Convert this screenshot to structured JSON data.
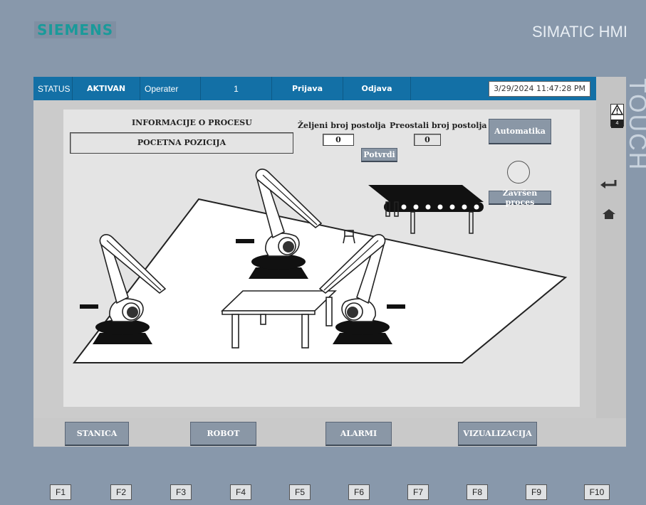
{
  "header": {
    "brand": "SIEMENS",
    "product": "SIMATIC HMI",
    "side_text": "TOUCH"
  },
  "status_bar": {
    "status_label": "STATUS",
    "status_value": "AKTIVAN",
    "user_label": "Operater",
    "user_level": "1",
    "login": "Prijava",
    "logout": "Odjava",
    "datetime": "3/29/2024 11:47:28 PM"
  },
  "side": {
    "alarm_count": "4",
    "warn_icon": "warning-icon",
    "enter_icon": "enter-icon",
    "home_icon": "home-icon"
  },
  "process": {
    "info_title": "INFORMACIJE O PROCESU",
    "info_value": "POCETNA POZICIJA",
    "desired_label": "Željeni broj postolja",
    "desired_value": "0",
    "remaining_label": "Preostali broj postolja",
    "remaining_value": "0",
    "confirm": "Potvrdi",
    "auto": "Automatika",
    "done": "Završen proces"
  },
  "nav": [
    "STANICA",
    "ROBOT",
    "ALARMI",
    "VIZUALIZACIJA"
  ],
  "fkeys": [
    "F1",
    "F2",
    "F3",
    "F4",
    "F5",
    "F6",
    "F7",
    "F8",
    "F9",
    "F10"
  ],
  "colors": {
    "status_bar": "#1370a6",
    "button": "#8a97a6",
    "bezel": "#8898ab",
    "brand": "#1a9a9a"
  }
}
